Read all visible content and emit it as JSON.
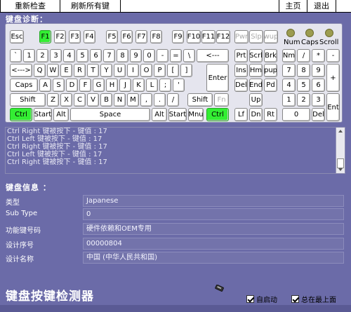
{
  "toolbar": {
    "recheck": "重新检查",
    "refresh": "刷新所有键",
    "home": "主页",
    "exit": "退出"
  },
  "diagnosis_title": "键盘诊断：",
  "keyboard": {
    "row1": [
      "Esc",
      "F1",
      "F2",
      "F3",
      "F4",
      "F5",
      "F6",
      "F7",
      "F8",
      "F9",
      "F10",
      "F11",
      "F12",
      "Pwr",
      "Slp",
      "wup"
    ],
    "row2": [
      "`",
      "1",
      "2",
      "3",
      "4",
      "5",
      "6",
      "7",
      "8",
      "9",
      "0",
      "-",
      "=",
      "\\",
      "<---",
      "Prt",
      "Scrl",
      "Brk",
      "Nm",
      "/",
      "*",
      "-"
    ],
    "row3": [
      "<--->",
      "Q",
      "W",
      "E",
      "R",
      "T",
      "Y",
      "U",
      "I",
      "O",
      "P",
      "[",
      "]",
      "Enter",
      "Ins",
      "Hm",
      "pup",
      "7",
      "8",
      "9",
      "+"
    ],
    "row4": [
      "Caps",
      "A",
      "S",
      "D",
      "F",
      "G",
      "H",
      "J",
      "K",
      "L",
      ";",
      "'",
      "Del",
      "End",
      "Pd",
      "4",
      "5",
      "6"
    ],
    "row5": [
      "Shift",
      "Z",
      "X",
      "C",
      "V",
      "B",
      "N",
      "M",
      ",",
      ".",
      "/",
      "Shift",
      "Fn",
      "Up",
      "1",
      "2",
      "3",
      "Ent"
    ],
    "row6": [
      "Ctrl",
      "Start",
      "Alt",
      "Space",
      "Alt",
      "Start",
      "Mnu",
      "Ctrl",
      "Lf",
      "Dn",
      "Rt",
      "0",
      "Del"
    ],
    "leds": [
      "Num",
      "Caps",
      "Scroll"
    ]
  },
  "log_lines": [
    "Ctrl Right  键被按下 - 键值 : 17",
    "Ctrl Left  键被按下 - 键值 : 17",
    "Ctrl Right  键被按下 - 键值 : 17",
    "Ctrl Left  键被按下 - 键值 : 17",
    "Ctrl Right  键被按下 - 键值 : 17"
  ],
  "info_title": "键盘信息 ：",
  "info": [
    {
      "label": "类型",
      "value": "Japanese"
    },
    {
      "label": "Sub Type",
      "value": "0"
    },
    {
      "label": "功能键号码",
      "value": "硬件依赖和OEM专用"
    },
    {
      "label": "设计序号",
      "value": "00000804"
    },
    {
      "label": "设计名称",
      "value": "中国 (中华人民共和国)"
    }
  ],
  "app_title": "键盘按键检测器",
  "checkboxes": {
    "autostart": "自启动",
    "topmost": "总在最上面"
  },
  "colors": {
    "background": "#6b6ba8",
    "pressed_key": "#33ee33",
    "led": "#9c9c50"
  }
}
